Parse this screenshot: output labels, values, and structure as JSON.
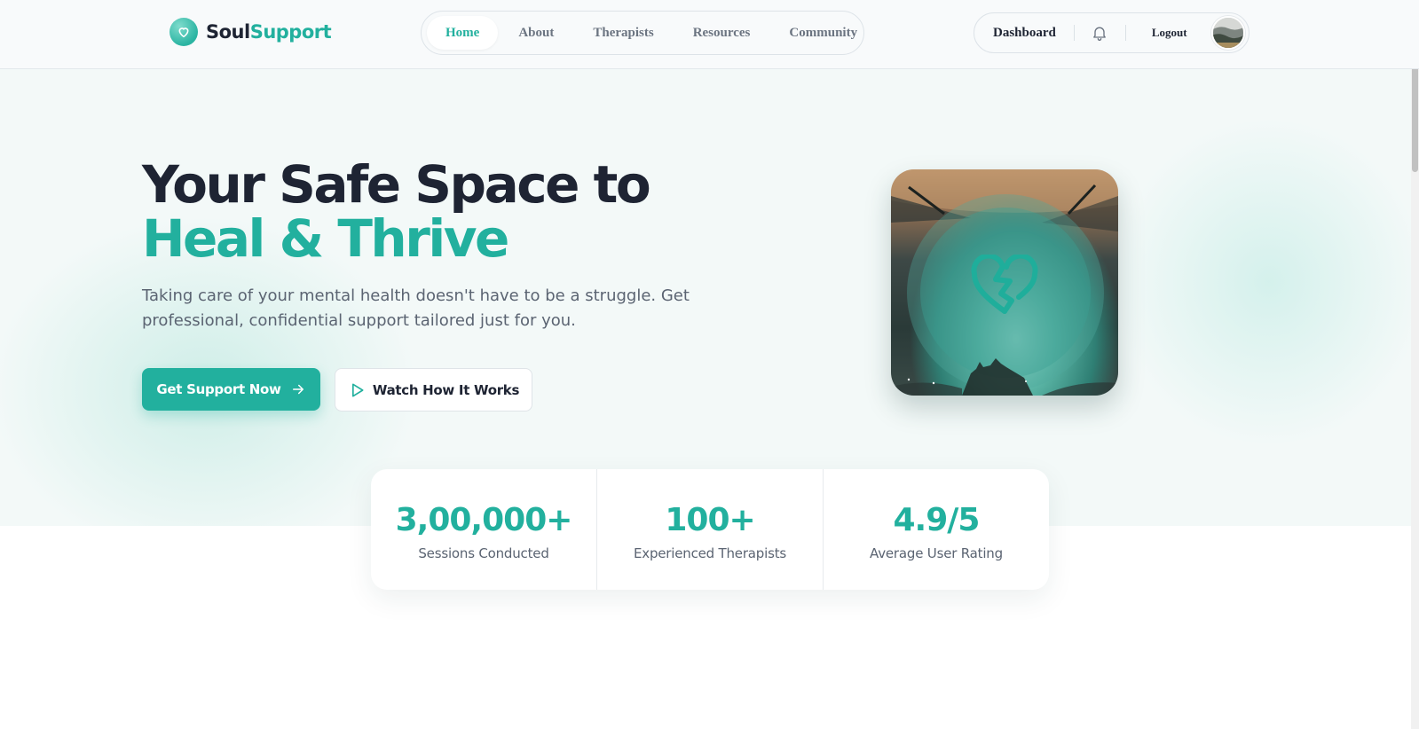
{
  "brand": {
    "name_part1": "Soul",
    "name_part2": "Support",
    "logo_icon": "heart-icon"
  },
  "nav": {
    "links": [
      {
        "label": "Home",
        "active": true
      },
      {
        "label": "About",
        "active": false
      },
      {
        "label": "Therapists",
        "active": false
      },
      {
        "label": "Resources",
        "active": false
      },
      {
        "label": "Community",
        "active": false
      }
    ]
  },
  "user_menu": {
    "dashboard_label": "Dashboard",
    "notification_icon": "bell-icon",
    "logout_label": "Logout",
    "avatar": "user-avatar"
  },
  "hero": {
    "title_line1": "Your Safe Space to",
    "title_line2": "Heal & Thrive",
    "subtitle": "Taking care of your mental health doesn't have to be a struggle. Get professional, confidential support tailored just for you.",
    "primary_button": "Get Support Now",
    "secondary_button": "Watch How It Works",
    "image_icon": "heart-puzzle-icon"
  },
  "stats": [
    {
      "value": "3,00,000+",
      "label": "Sessions Conducted"
    },
    {
      "value": "100+",
      "label": "Experienced Therapists"
    },
    {
      "value": "4.9/5",
      "label": "Average User Rating"
    }
  ],
  "colors": {
    "accent": "#22b09e",
    "heading": "#1e2433",
    "muted": "#5b6472",
    "hero_bg": "#f3f9f8"
  }
}
